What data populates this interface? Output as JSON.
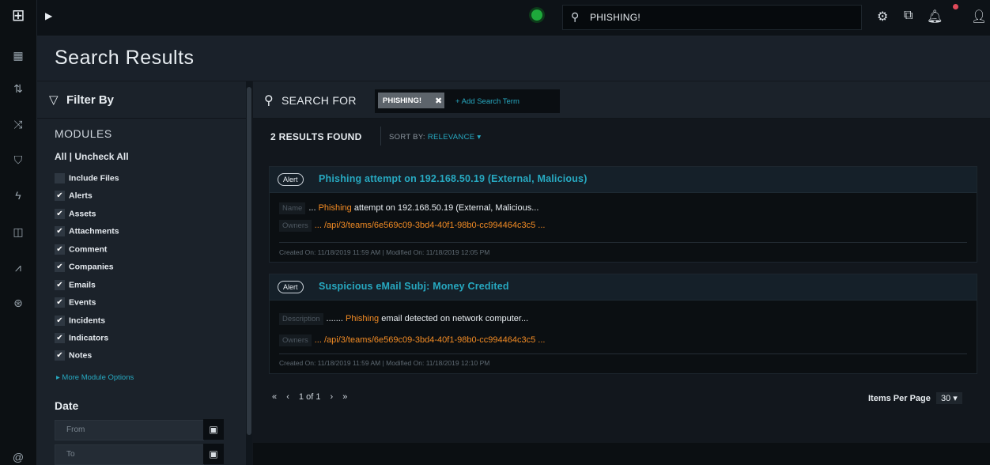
{
  "topbar": {
    "toggle_icon": "play-triangle-icon",
    "search_value": "PHISHING!",
    "status_color": "#1ea83b",
    "accent": "#27a9c1"
  },
  "page": {
    "title": "Search Results"
  },
  "filter": {
    "heading": "Filter By",
    "modules_label": "MODULES",
    "all_uncheck": "All | Uncheck All",
    "modules": [
      {
        "label": "Include Files",
        "checked": false
      },
      {
        "label": "Alerts",
        "checked": true
      },
      {
        "label": "Assets",
        "checked": true
      },
      {
        "label": "Attachments",
        "checked": true
      },
      {
        "label": "Comment",
        "checked": true
      },
      {
        "label": "Companies",
        "checked": true
      },
      {
        "label": "Emails",
        "checked": true
      },
      {
        "label": "Events",
        "checked": true
      },
      {
        "label": "Incidents",
        "checked": true
      },
      {
        "label": "Indicators",
        "checked": true
      },
      {
        "label": "Notes",
        "checked": true
      }
    ],
    "more_options": "More Module Options",
    "date_heading": "Date",
    "from_placeholder": "From",
    "to_placeholder": "To"
  },
  "search": {
    "label": "SEARCH FOR",
    "term": "PHISHING!",
    "add_term": "+ Add Search Term",
    "results_found": "2 RESULTS FOUND",
    "sort_label": "SORT BY:",
    "sort_value": "RELEVANCE"
  },
  "results": [
    {
      "badge": "Alert",
      "title": "Phishing attempt on 192.168.50.19 (External, Malicious)",
      "field1_tag": "Name",
      "field1_prefix": "... ",
      "field1_highlight": "Phishing",
      "field1_rest": " attempt on 192.168.50.19 (External, Malicious...",
      "owners_tag": "Owners",
      "owners_value": "... /api/3/teams/6e569c09-3bd4-40f1-98b0-cc994464c3c5 ...",
      "meta": "Created On:  11/18/2019 11:59 AM   |   Modified On:  11/18/2019 12:05 PM"
    },
    {
      "badge": "Alert",
      "title": "Suspicious eMail Subj: Money Credited",
      "field1_tag": "Description",
      "field1_prefix": "....... ",
      "field1_highlight": "Phishing",
      "field1_rest": " email detected on network computer...",
      "owners_tag": "Owners",
      "owners_value": "... /api/3/teams/6e569c09-3bd4-40f1-98b0-cc994464c3c5 ...",
      "meta": "Created On:  11/18/2019 11:59 AM   |   Modified On:  11/18/2019 12:10 PM"
    }
  ],
  "pagination": {
    "first": "«",
    "prev": "‹",
    "page_text": "1 of 1",
    "next": "›",
    "last": "»",
    "items_per_page_label": "Items Per Page",
    "items_per_page_value": "30"
  }
}
